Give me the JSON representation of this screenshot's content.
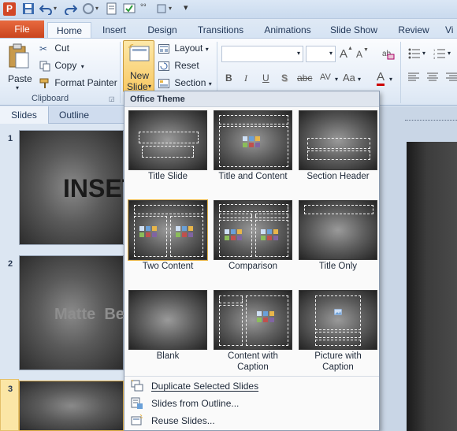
{
  "quick_access": {
    "icons": [
      "powerpoint-logo",
      "save-icon",
      "undo-icon",
      "redo-icon",
      "repeat-icon",
      "print-preview-icon",
      "spelling-icon",
      "numbering-icon",
      "more-icon",
      "customize-icon"
    ]
  },
  "app_logo": "P",
  "tabs": [
    "File",
    "Home",
    "Insert",
    "Design",
    "Transitions",
    "Animations",
    "Slide Show",
    "Review",
    "Vi"
  ],
  "ribbon": {
    "clipboard": {
      "paste": "Paste",
      "cut": "Cut",
      "copy": "Copy",
      "format_painter": "Format Painter",
      "group_label": "Clipboard"
    },
    "slides": {
      "new_slide_line1": "New",
      "new_slide_line2": "Slide",
      "layout": "Layout",
      "reset": "Reset",
      "section": "Section"
    },
    "font": {
      "bold": "B",
      "italic": "I",
      "underline": "U",
      "shadow": "S",
      "strikethrough": "abc",
      "spacing": "AV",
      "case": "Aa",
      "grow": "A",
      "shrink": "A",
      "color": "A"
    }
  },
  "pane_tabs": [
    "Slides",
    "Outline"
  ],
  "slides": [
    {
      "num": "1",
      "text": "INSET"
    },
    {
      "num": "2",
      "text": "Matte  Bev"
    },
    {
      "num": "3",
      "text": ""
    }
  ],
  "dropdown": {
    "header": "Office Theme",
    "layouts": [
      "Title Slide",
      "Title and Content",
      "Section Header",
      "Two Content",
      "Comparison",
      "Title Only",
      "Blank",
      "Content with Caption",
      "Picture with Caption"
    ],
    "menu": [
      "Duplicate Selected Slides",
      "Slides from Outline...",
      "Reuse Slides..."
    ]
  },
  "colors": {
    "file_tab": "#d24726",
    "accent": "#e8b64a"
  }
}
